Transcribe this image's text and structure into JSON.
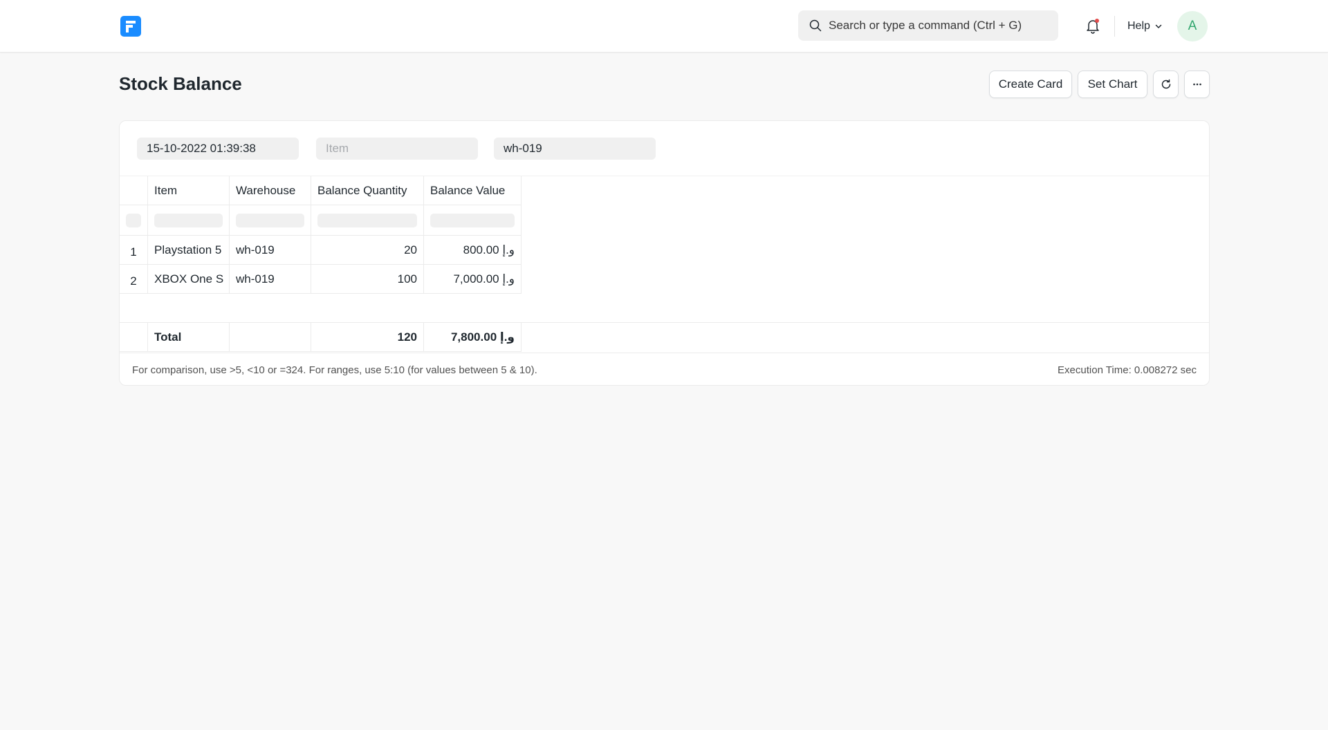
{
  "navbar": {
    "logo_icon": "frappe-logo-icon",
    "search_placeholder": "Search or type a command (Ctrl + G)",
    "help_label": "Help",
    "avatar_initial": "A",
    "accent_color": "#1a8cff",
    "notification_dot_color": "#e24c4c"
  },
  "page": {
    "title": "Stock Balance",
    "actions": {
      "create_card": "Create Card",
      "set_chart": "Set Chart",
      "refresh_icon": "refresh-icon",
      "more_icon": "more-horizontal-icon"
    }
  },
  "filters": {
    "date_value": "15-10-2022 01:39:38",
    "item_placeholder": "Item",
    "item_value": "",
    "warehouse_value": "wh-019"
  },
  "table": {
    "columns": [
      "Item",
      "Warehouse",
      "Balance Quantity",
      "Balance Value"
    ],
    "rows": [
      {
        "index": "1",
        "item": "Playstation 5",
        "warehouse": "wh-019",
        "qty": "20",
        "value": "800.00 و.إ"
      },
      {
        "index": "2",
        "item": "XBOX One S",
        "warehouse": "wh-019",
        "qty": "100",
        "value": "7,000.00 و.إ"
      }
    ],
    "total": {
      "label": "Total",
      "warehouse": "",
      "qty": "120",
      "value": "7,800.00 و.إ"
    }
  },
  "footer": {
    "hint": "For comparison, use >5, <10 or =324. For ranges, use 5:10 (for values between 5 & 10).",
    "execution_time": "Execution Time: 0.008272 sec"
  }
}
